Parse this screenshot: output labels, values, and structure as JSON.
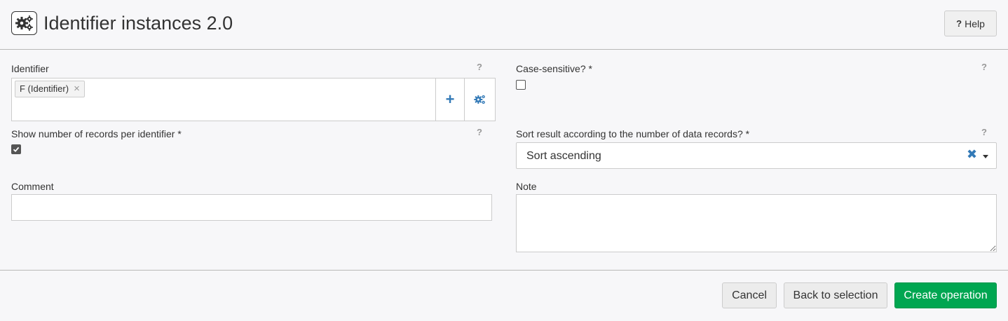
{
  "header": {
    "title": "Identifier instances 2.0",
    "icon": "gears-icon",
    "help_label": "Help"
  },
  "form": {
    "identifier": {
      "label": "Identifier",
      "help": "?",
      "tags": [
        {
          "label": "F (Identifier)",
          "remove": "×"
        }
      ],
      "add_icon": "+"
    },
    "case_sensitive": {
      "label": "Case-sensitive? *",
      "help": "?",
      "checked": false
    },
    "show_count": {
      "label": "Show number of records per identifier *",
      "help": "?",
      "checked": true
    },
    "sort": {
      "label": "Sort result according to the number of data records? *",
      "help": "?",
      "value": "Sort ascending",
      "clear_icon": "✖"
    },
    "comment": {
      "label": "Comment",
      "value": ""
    },
    "note": {
      "label": "Note",
      "value": ""
    }
  },
  "footer": {
    "cancel_label": "Cancel",
    "back_label": "Back to selection",
    "create_label": "Create operation"
  },
  "colors": {
    "accent": "#337ab7",
    "primary_button": "#00a651",
    "background": "#f7f7f9"
  }
}
